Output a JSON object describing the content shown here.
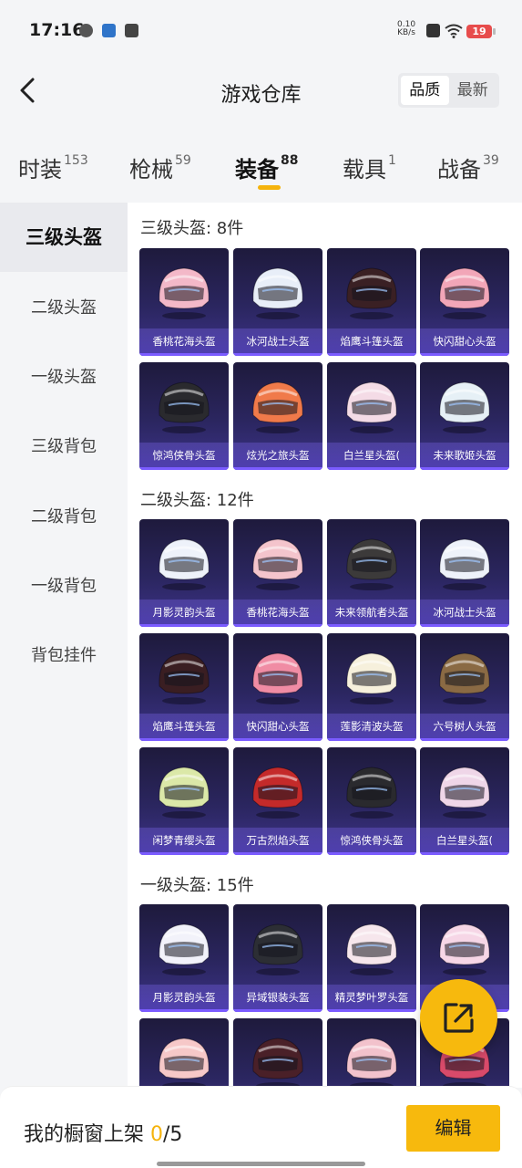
{
  "status_bar": {
    "time": "17:16",
    "net_speed_value": "0.10",
    "net_speed_unit": "KB/s",
    "battery": "19"
  },
  "header": {
    "title": "游戏仓库",
    "sort_quality": "品质",
    "sort_latest": "最新"
  },
  "tabs": [
    {
      "label": "时装",
      "count": "153"
    },
    {
      "label": "枪械",
      "count": "59"
    },
    {
      "label": "装备",
      "count": "88"
    },
    {
      "label": "载具",
      "count": "1"
    },
    {
      "label": "战备",
      "count": "39"
    }
  ],
  "sidebar": [
    {
      "label": "三级头盔"
    },
    {
      "label": "二级头盔"
    },
    {
      "label": "一级头盔"
    },
    {
      "label": "三级背包"
    },
    {
      "label": "二级背包"
    },
    {
      "label": "一级背包"
    },
    {
      "label": "背包挂件"
    }
  ],
  "sections": [
    {
      "title": "三级头盔: 8件",
      "items": [
        {
          "name": "香桃花海头盔",
          "color": "#f3b8c8"
        },
        {
          "name": "冰河战士头盔",
          "color": "#e8eef8"
        },
        {
          "name": "焰鹰斗篷头盔",
          "color": "#3a2024"
        },
        {
          "name": "快闪甜心头盔",
          "color": "#f2a6b8"
        },
        {
          "name": "惊鸿侠骨头盔",
          "color": "#2a2a2e"
        },
        {
          "name": "炫光之旅头盔",
          "color": "#f07a4a"
        },
        {
          "name": "白兰星头盔(",
          "color": "#f4dbe6"
        },
        {
          "name": "未来歌姬头盔",
          "color": "#e6f0f6"
        }
      ]
    },
    {
      "title": "二级头盔: 12件",
      "items": [
        {
          "name": "月影灵韵头盔",
          "color": "#eef2fa"
        },
        {
          "name": "香桃花海头盔",
          "color": "#f4c4cc"
        },
        {
          "name": "未来领航者头盔",
          "color": "#3c3a3a"
        },
        {
          "name": "冰河战士头盔",
          "color": "#eef2fa"
        },
        {
          "name": "焰鹰斗篷头盔",
          "color": "#3a1e22"
        },
        {
          "name": "快闪甜心头盔",
          "color": "#f08ca4"
        },
        {
          "name": "莲影清波头盔",
          "color": "#f6f0dc"
        },
        {
          "name": "六号树人头盔",
          "color": "#8a6a44"
        },
        {
          "name": "闲梦青缨头盔",
          "color": "#dbe8a8"
        },
        {
          "name": "万古烈焰头盔",
          "color": "#c42a2a"
        },
        {
          "name": "惊鸿侠骨头盔",
          "color": "#2a2a2e"
        },
        {
          "name": "白兰星头盔(",
          "color": "#efd6e8"
        }
      ]
    },
    {
      "title": "一级头盔: 15件",
      "items": [
        {
          "name": "月影灵韵头盔",
          "color": "#f2f2fa"
        },
        {
          "name": "异域银装头盔",
          "color": "#2c2e34"
        },
        {
          "name": "精灵梦叶罗头盔",
          "color": "#f6e6ec"
        },
        {
          "name": "",
          "color": "#f6d6e6"
        },
        {
          "name": "",
          "color": "#f6c8c8"
        },
        {
          "name": "",
          "color": "#4a2028"
        },
        {
          "name": "",
          "color": "#f2c2cc"
        },
        {
          "name": "",
          "color": "#d84a6a"
        }
      ]
    }
  ],
  "bottom": {
    "label_prefix": "我的橱窗上架 ",
    "count": "0",
    "total": "/5",
    "edit_button": "编辑"
  }
}
